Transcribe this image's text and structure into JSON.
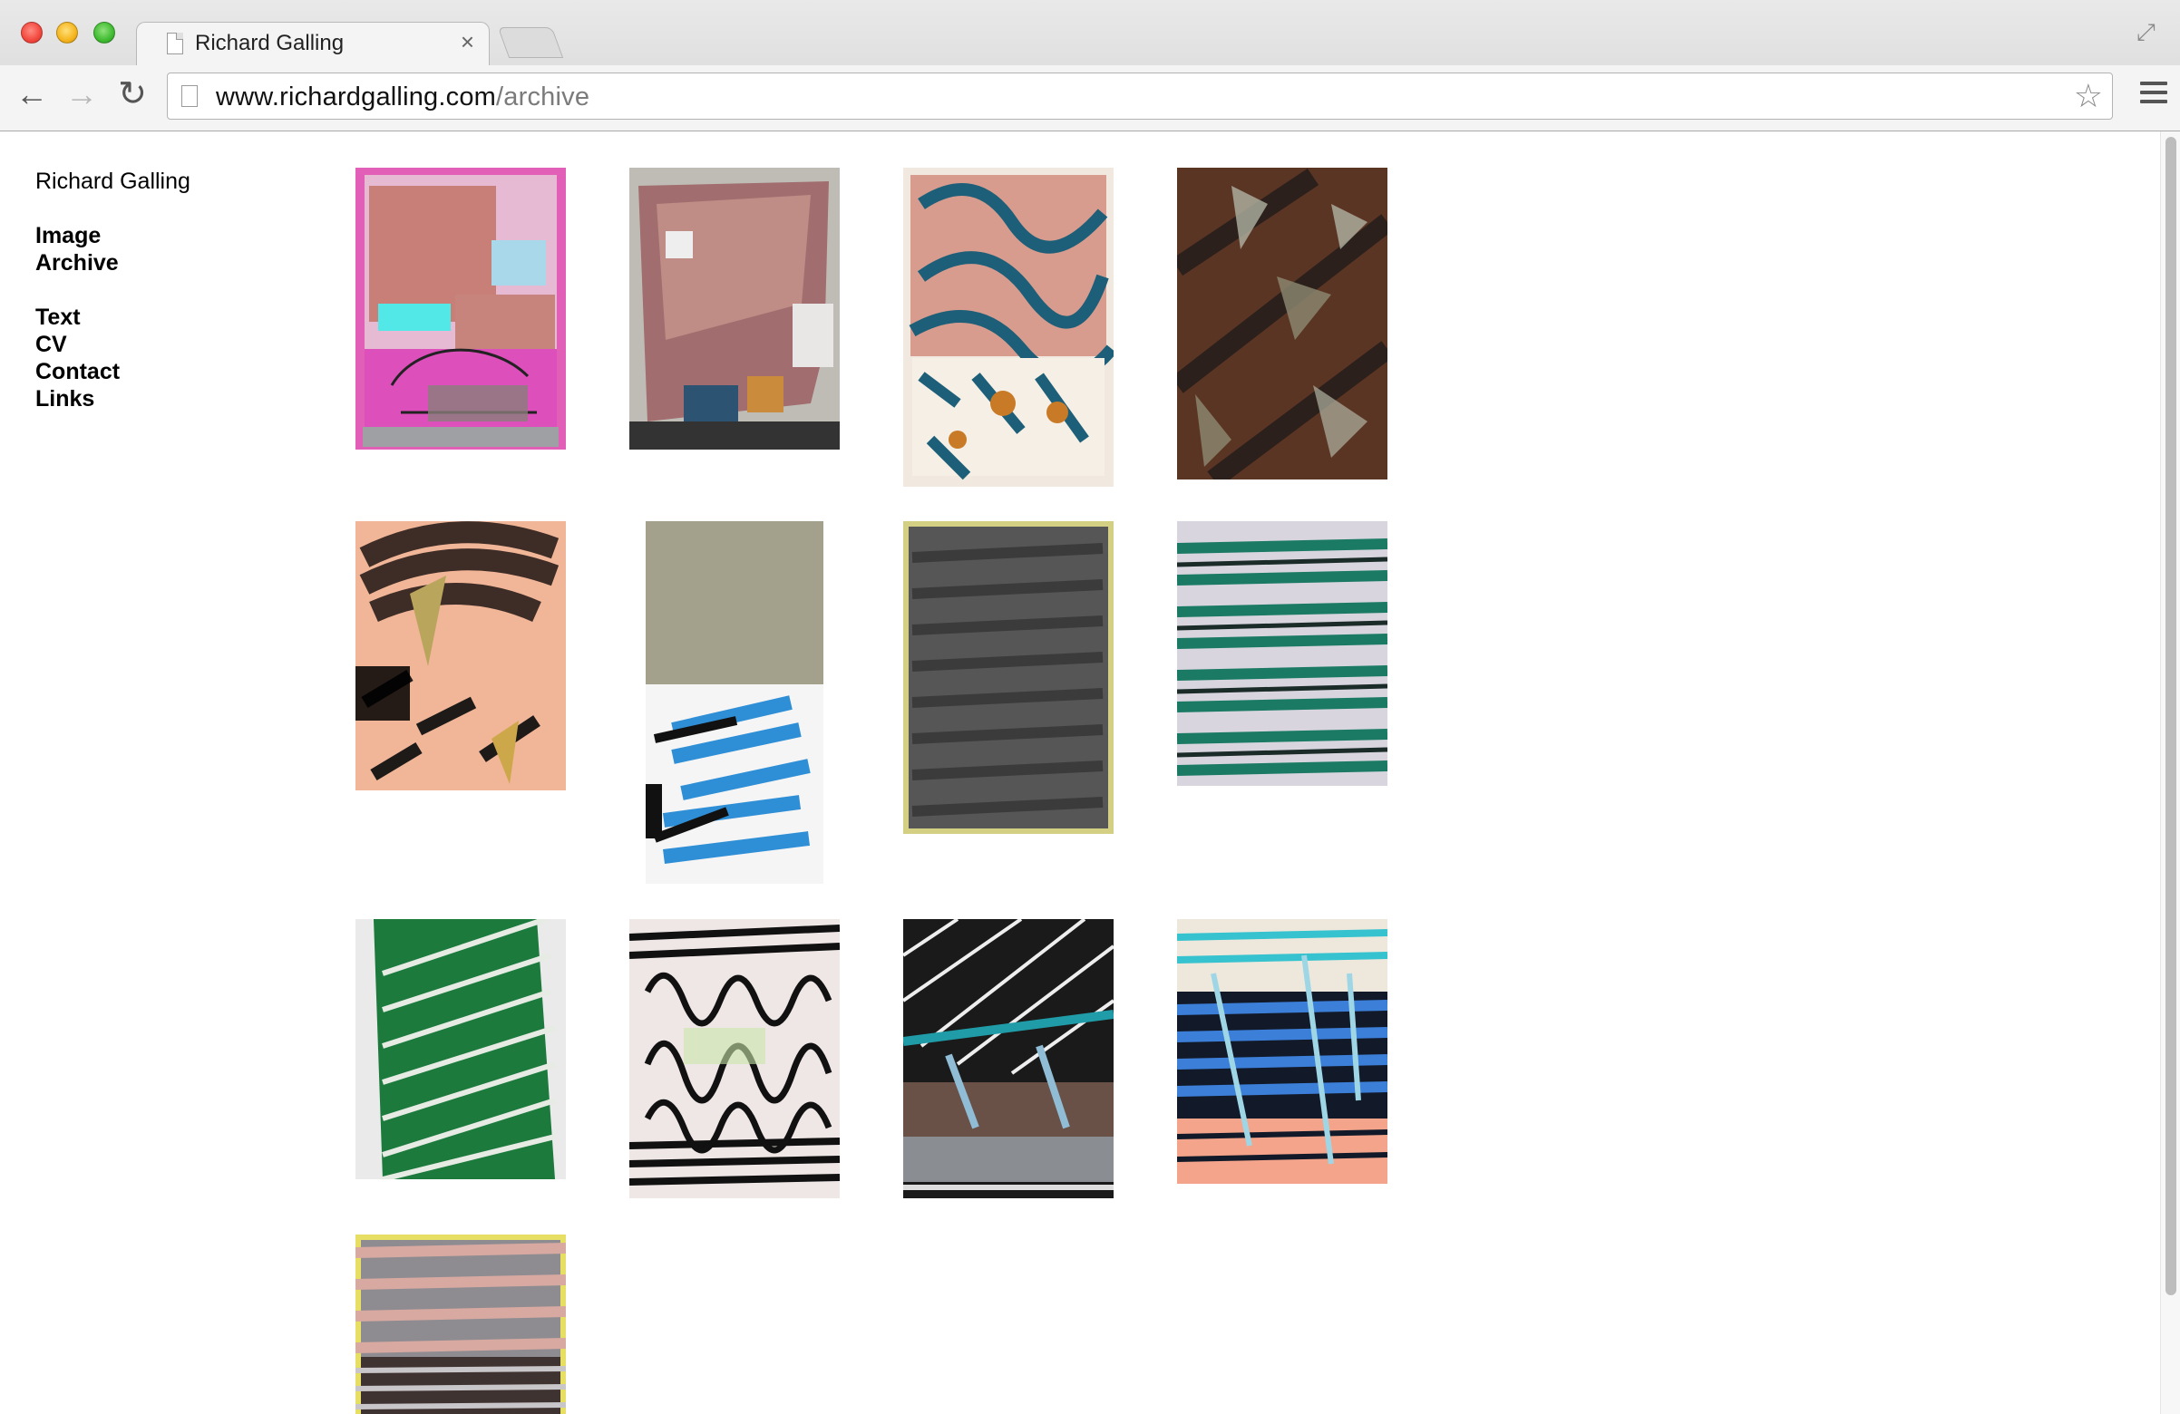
{
  "browser": {
    "tab_title": "Richard Galling",
    "url_host": "www.richardgalling.com",
    "url_path": "/archive"
  },
  "sidebar": {
    "site_name": "Richard Galling",
    "nav_primary": [
      "Image",
      "Archive"
    ],
    "nav_secondary": [
      "Text",
      "CV",
      "Contact",
      "Links"
    ]
  },
  "gallery": {
    "item_count": 13
  }
}
